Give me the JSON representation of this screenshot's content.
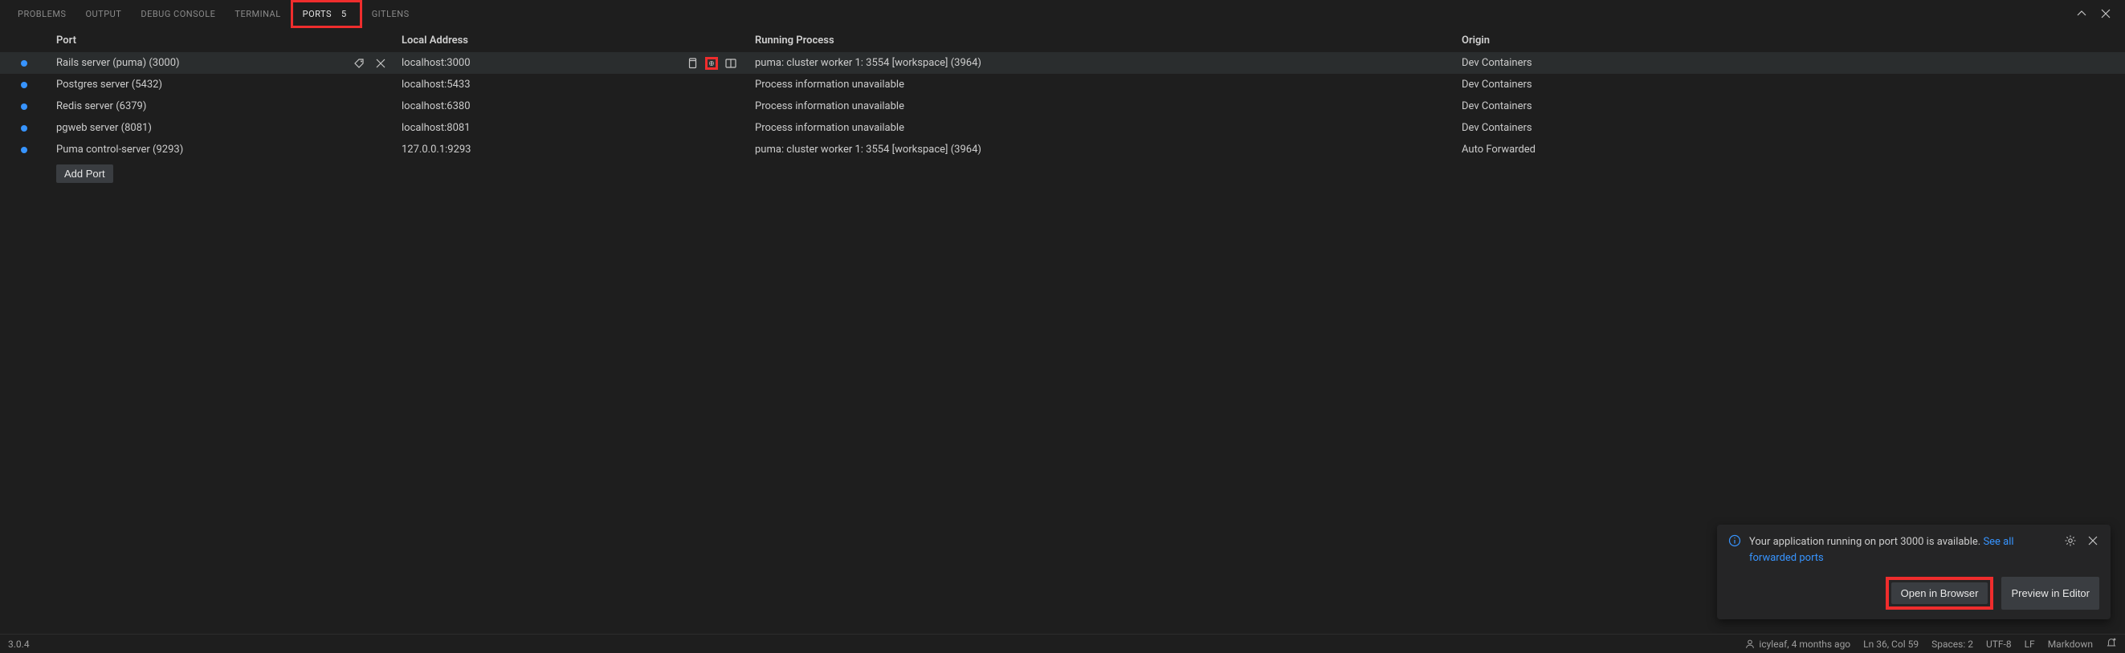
{
  "tabs": {
    "problems": "PROBLEMS",
    "output": "OUTPUT",
    "debug_console": "DEBUG CONSOLE",
    "terminal": "TERMINAL",
    "ports": "PORTS",
    "ports_badge": "5",
    "gitlens": "GITLENS"
  },
  "headers": {
    "port": "Port",
    "local_address": "Local Address",
    "running_process": "Running Process",
    "origin": "Origin"
  },
  "rows": [
    {
      "port": "Rails server (puma) (3000)",
      "local": "localhost:3000",
      "process": "puma: cluster worker 1: 3554 [workspace] (3964)",
      "origin": "Dev Containers",
      "hovered": true
    },
    {
      "port": "Postgres server (5432)",
      "local": "localhost:5433",
      "process": "Process information unavailable",
      "origin": "Dev Containers",
      "hovered": false
    },
    {
      "port": "Redis server (6379)",
      "local": "localhost:6380",
      "process": "Process information unavailable",
      "origin": "Dev Containers",
      "hovered": false
    },
    {
      "port": "pgweb server (8081)",
      "local": "localhost:8081",
      "process": "Process information unavailable",
      "origin": "Dev Containers",
      "hovered": false
    },
    {
      "port": "Puma control-server (9293)",
      "local": "127.0.0.1:9293",
      "process": "puma: cluster worker 1: 3554 [workspace] (3964)",
      "origin": "Auto Forwarded",
      "hovered": false
    }
  ],
  "add_port_label": "Add Port",
  "toast": {
    "message_pre": "Your application running on port 3000 is available. ",
    "link": "See all forwarded ports",
    "open_browser": "Open in Browser",
    "preview_editor": "Preview in Editor"
  },
  "status": {
    "version": "3.0.4",
    "blame": "icyleaf, 4 months ago",
    "lncol": "Ln 36, Col 59",
    "spaces": "Spaces: 2",
    "encoding": "UTF-8",
    "eol": "LF",
    "lang": "Markdown"
  }
}
